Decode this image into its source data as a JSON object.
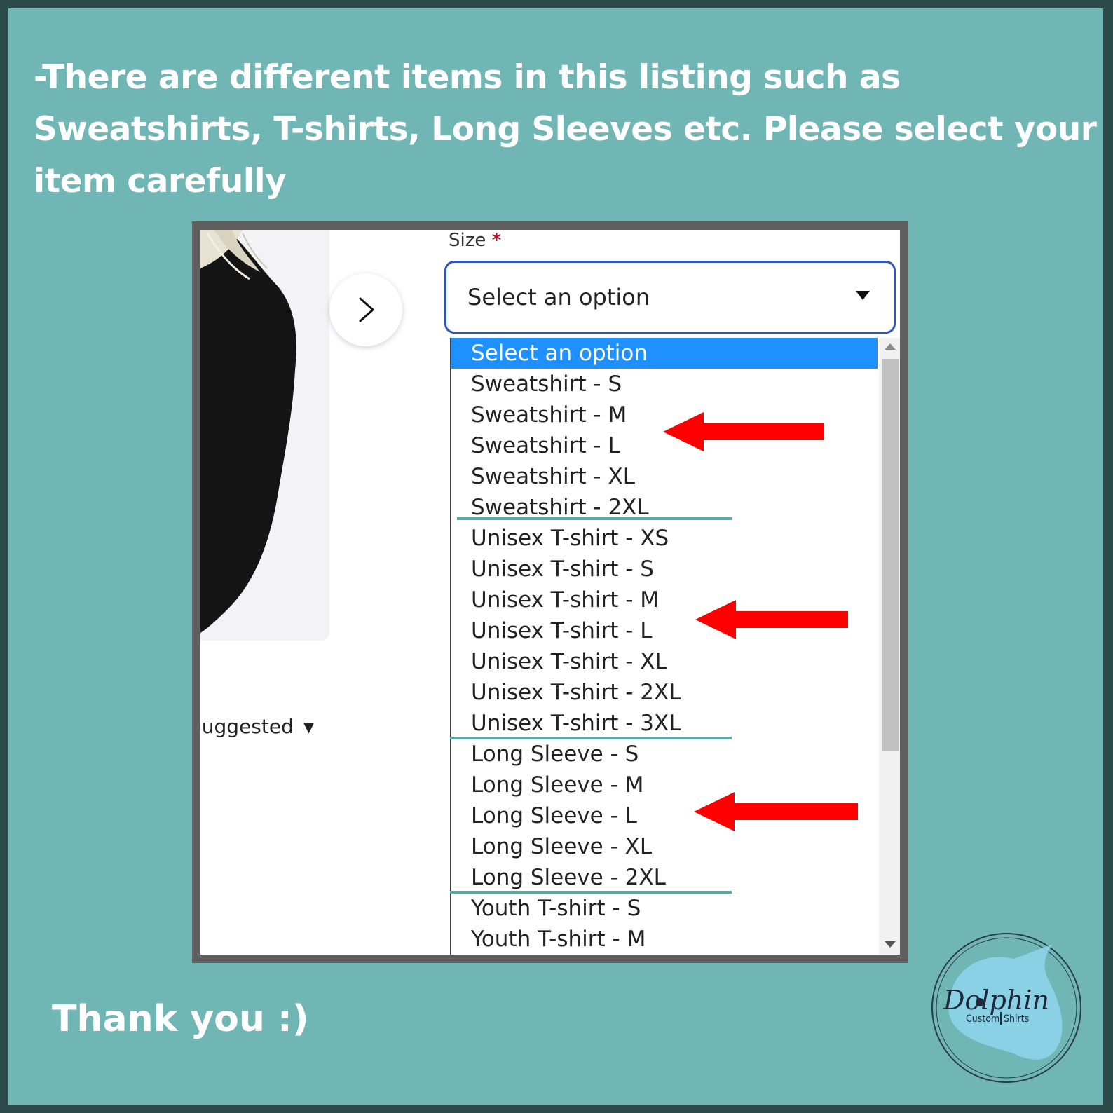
{
  "headline": "-There are different items in this listing such as Sweatshirts, T-shirts, Long Sleeves etc. Please select your item carefully",
  "footer": {
    "thanks": "Thank you :)"
  },
  "screenshot": {
    "field_label": "Size",
    "required_mark": "*",
    "select": {
      "value": "Select an option",
      "arrow_icon": "caret-down-icon"
    },
    "next_button_icon": "chevron-right-icon",
    "sort": {
      "label": "Suggested",
      "icon": "caret-down-icon"
    },
    "options": [
      {
        "label": "Select an option",
        "selected": true
      },
      {
        "label": "Sweatshirt - S"
      },
      {
        "label": "Sweatshirt - M"
      },
      {
        "label": "Sweatshirt - L"
      },
      {
        "label": "Sweatshirt - XL"
      },
      {
        "label": "Sweatshirt - 2XL"
      },
      {
        "label": "Unisex T-shirt - XS"
      },
      {
        "label": "Unisex T-shirt - S"
      },
      {
        "label": "Unisex T-shirt - M"
      },
      {
        "label": "Unisex T-shirt - L"
      },
      {
        "label": "Unisex T-shirt - XL"
      },
      {
        "label": "Unisex T-shirt - 2XL"
      },
      {
        "label": "Unisex T-shirt - 3XL"
      },
      {
        "label": "Long Sleeve - S"
      },
      {
        "label": "Long Sleeve - M"
      },
      {
        "label": "Long Sleeve - L"
      },
      {
        "label": "Long Sleeve - XL"
      },
      {
        "label": "Long Sleeve - 2XL"
      },
      {
        "label": "Youth T-shirt - S"
      },
      {
        "label": "Youth T-shirt - M"
      }
    ]
  },
  "logo": {
    "name": "Dolphin",
    "sub_left": "Custom",
    "sub_right": "Shirts"
  },
  "colors": {
    "background": "#6fb6b5",
    "frame": "#2c4a4a",
    "highlight": "#1e90ff",
    "focus_border": "#2f55b9",
    "arrow": "#ff0000",
    "separator": "#5aa9a7"
  }
}
